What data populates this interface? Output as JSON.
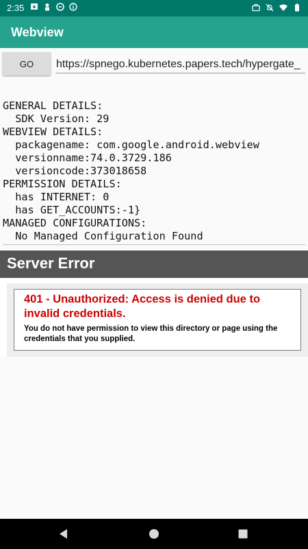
{
  "status_bar": {
    "time": "2:35",
    "left_icons": [
      "download-icon",
      "person-icon",
      "sync-icon",
      "info-icon"
    ],
    "right_icons": [
      "briefcase-icon",
      "notifications-off-icon",
      "wifi-icon",
      "battery-icon"
    ]
  },
  "app_bar": {
    "title": "Webview"
  },
  "toolbar": {
    "go_label": "GO",
    "url_value": "https://spnego.kubernetes.papers.tech/hypergate_"
  },
  "details": {
    "lines": [
      "GENERAL DETAILS:",
      "  SDK Version: 29",
      "WEBVIEW DETAILS:",
      "  packagename: com.google.android.webview",
      "  versionname:74.0.3729.186",
      "  versioncode:373018658",
      "PERMISSION DETAILS:",
      "  has INTERNET: 0",
      "  has GET_ACCOUNTS:-1}",
      "MANAGED CONFIGURATIONS:",
      "  No Managed Configuration Found"
    ]
  },
  "webview": {
    "header": "Server Error",
    "error_heading": "401 - Unauthorized: Access is denied due to invalid credentials.",
    "error_message": "You do not have permission to view this directory or page using the credentials that you supplied."
  },
  "colors": {
    "status_bar": "#00796b",
    "app_bar": "#26a38e",
    "error_header_bg": "#555555",
    "error_text": "#cc0000"
  },
  "nav_bar": {
    "buttons": [
      "back-icon",
      "home-icon",
      "recents-icon"
    ]
  }
}
